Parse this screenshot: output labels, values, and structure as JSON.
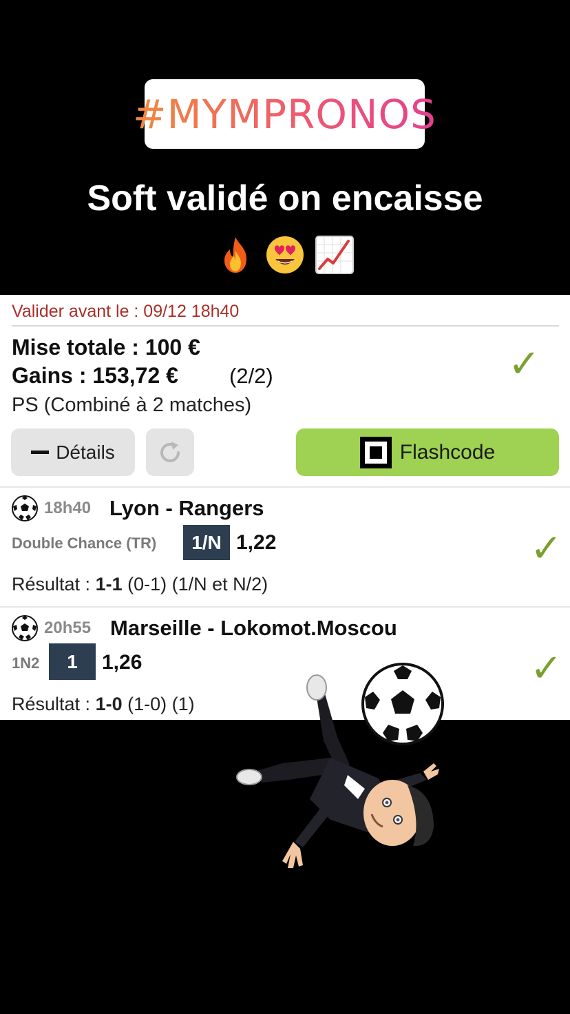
{
  "story": {
    "hashtag": "#MYMPRONOS",
    "headline": "Soft validé on encaisse",
    "emojis": [
      "fire",
      "heart-eyes",
      "chart-increasing"
    ]
  },
  "bet": {
    "deadline": "Valider avant le : 09/12 18h40",
    "mise": "Mise totale : 100 €",
    "gains": "Gains : 153,72 €",
    "gains_count": "(2/2)",
    "type": "PS (Combiné à 2 matches)",
    "details_label": "Détails",
    "flashcode_label": "Flashcode",
    "status": "won"
  },
  "matches": [
    {
      "time": "18h40",
      "teams": "Lyon - Rangers",
      "market": "Double Chance (TR)",
      "pick": "1/N",
      "odds": "1,22",
      "result_label": "Résultat :",
      "score": "1-1",
      "result_detail": "(0-1) (1/N et N/2)"
    },
    {
      "time": "20h55",
      "teams": "Marseille - Lokomot.Moscou",
      "market": "1N2",
      "pick": "1",
      "odds": "1,26",
      "result_label": "Résultat :",
      "score": "1-0",
      "result_detail": "(1-0) (1)"
    }
  ],
  "colors": {
    "check": "#7aa12f",
    "flashcode_button": "#9fd152",
    "deadline": "#a8302a",
    "pick_badge": "#2c3e50"
  }
}
